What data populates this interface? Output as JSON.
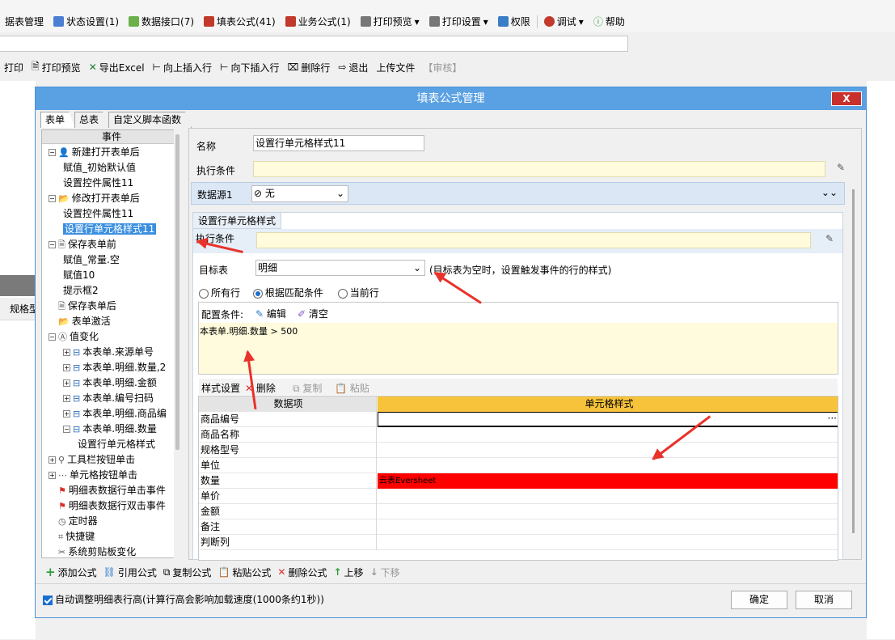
{
  "toolbar1": {
    "items": [
      "据表管理",
      "状态设置(1)",
      "数据接口(7)",
      "填表公式(41)",
      "业务公式(1)",
      "打印预览",
      "打印设置",
      "权限",
      "调试",
      "帮助"
    ]
  },
  "toolbar2": {
    "items": [
      "打印",
      "打印预览",
      "导出Excel",
      "向上插入行",
      "向下插入行",
      "删除行",
      "退出",
      "上传文件",
      "【审核】"
    ]
  },
  "background": {
    "label_row": "规格型"
  },
  "dialog": {
    "title": "填表公式管理",
    "close": "X",
    "tabs": [
      "表单",
      "总表",
      "自定义脚本函数"
    ],
    "tree_header": "事件",
    "tree": [
      "新建打开表单后",
      "赋值_初始默认值",
      "设置控件属性11",
      "修改打开表单后",
      "设置控件属性11",
      "设置行单元格样式11",
      "保存表单前",
      "赋值_常量.空",
      "赋值10",
      "提示框2",
      "保存表单后",
      "表单激活",
      "值变化",
      "本表单.来源单号",
      "本表单.明细.数量,2",
      "本表单.明细.金额",
      "本表单.编号扫码",
      "本表单.明细.商品编",
      "本表单.明细.数量",
      "设置行单元格样式",
      "工具栏按钮单击",
      "单元格按钮单击",
      "明细表数据行单击事件",
      "明细表数据行双击事件",
      "定时器",
      "快捷键",
      "系统剪贴板变化"
    ],
    "form": {
      "name_label": "名称",
      "name_value": "设置行单元格样式11",
      "exec_label": "执行条件",
      "datasource_label": "数据源1",
      "datasource_value": "无",
      "section_title": "设置行单元格样式",
      "section_exec_label": "执行条件",
      "target_label": "目标表",
      "target_value": "明细",
      "target_hint": "(目标表为空时，设置触发事件的行的样式)",
      "radio_all": "所有行",
      "radio_match": "根据匹配条件",
      "radio_current": "当前行",
      "cond_label": "配置条件:",
      "edit_label": "编辑",
      "clear_label": "清空",
      "cond_text": "本表单.明细.数量  > 500",
      "style_label": "样式设置",
      "delete_label": "删除",
      "copy_label": "复制",
      "paste_label": "粘贴",
      "col_data": "数据项",
      "col_style": "单元格样式",
      "rows": [
        "商品编号",
        "商品名称",
        "规格型号",
        "单位",
        "数量",
        "单价",
        "金额",
        "备注",
        "判断列"
      ],
      "qty_style_text": "云表Eversheet",
      "qty_style_color": "#ff0000"
    },
    "bottom": {
      "add": "添加公式",
      "ref": "引用公式",
      "copy": "复制公式",
      "paste": "粘贴公式",
      "del": "删除公式",
      "up": "上移",
      "down": "下移",
      "auto_height": "自动调整明细表行高(计算行高会影响加载速度(1000条约1秒))",
      "ok": "确定",
      "cancel": "取消"
    }
  }
}
